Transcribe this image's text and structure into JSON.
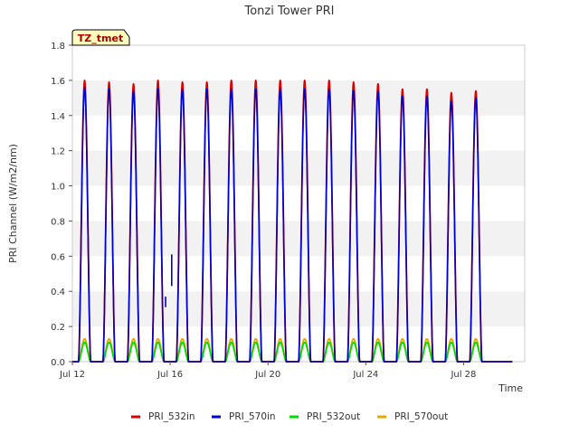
{
  "chart_data": {
    "type": "line",
    "title": "Tonzi Tower PRI",
    "xlabel": "Time",
    "ylabel": "PRI Channel (W/m2/nm)",
    "ylim": [
      0,
      1.8
    ],
    "xlim": [
      "2024-07-12T00:00",
      "2024-07-30T12:00"
    ],
    "x_axis_type": "date",
    "yticks": [
      "0.0",
      "0.2",
      "0.4",
      "0.6",
      "0.8",
      "1.0",
      "1.2",
      "1.4",
      "1.6",
      "1.8"
    ],
    "xticks": [
      "Jul 12",
      "Jul 16",
      "Jul 20",
      "Jul 24",
      "Jul 28"
    ],
    "grid": "horizontal bands",
    "legend_position": "bottom",
    "annotation": "TZ_tmet",
    "days": [
      "Jul 12",
      "Jul 13",
      "Jul 14",
      "Jul 15",
      "Jul 16",
      "Jul 17",
      "Jul 18",
      "Jul 19",
      "Jul 20",
      "Jul 21",
      "Jul 22",
      "Jul 23",
      "Jul 24",
      "Jul 25",
      "Jul 26",
      "Jul 27",
      "Jul 28",
      "Jul 29"
    ],
    "series": [
      {
        "name": "PRI_532in",
        "color": "#dd0000",
        "daily_peak": [
          1.6,
          1.59,
          1.58,
          1.6,
          1.59,
          1.59,
          1.6,
          1.6,
          1.6,
          1.6,
          1.6,
          1.59,
          1.58,
          1.55,
          1.55,
          1.53,
          1.54,
          null
        ]
      },
      {
        "name": "PRI_570in",
        "color": "#0000cc",
        "daily_peak": [
          1.56,
          1.55,
          1.54,
          1.55,
          1.55,
          1.55,
          1.55,
          1.55,
          1.55,
          1.55,
          1.55,
          1.54,
          1.54,
          1.51,
          1.51,
          1.48,
          1.5,
          null
        ]
      },
      {
        "name": "PRI_532out",
        "color": "#00dd00",
        "daily_peak": [
          0.11,
          0.11,
          0.11,
          0.11,
          0.11,
          0.11,
          0.11,
          0.11,
          0.11,
          0.11,
          0.11,
          0.11,
          0.11,
          0.11,
          0.11,
          0.11,
          0.11,
          null
        ]
      },
      {
        "name": "PRI_570out",
        "color": "#e6a800",
        "daily_peak": [
          0.13,
          0.13,
          0.13,
          0.13,
          0.13,
          0.13,
          0.13,
          0.13,
          0.13,
          0.13,
          0.13,
          0.13,
          0.13,
          0.13,
          0.13,
          0.13,
          0.13,
          null
        ]
      }
    ],
    "spikes": [
      {
        "series": "PRI_570in",
        "date": "2024-07-15T19:30",
        "low": 0.31,
        "high": 0.37
      },
      {
        "series": "PRI_570in",
        "date": "2024-07-16T01:30",
        "low": 0.43,
        "high": 0.61
      }
    ]
  }
}
